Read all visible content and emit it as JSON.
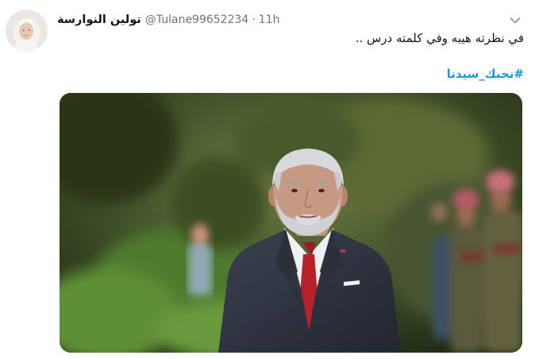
{
  "tweet": {
    "display_name": "تولين النوارسة",
    "handle": "@Tulane99652234",
    "separator": "·",
    "time": "11h",
    "text": "في نظرته هيبه وفي كلمته درس ..",
    "hashtag": "#نحبك_سيدنا"
  },
  "icons": {
    "menu": "chevron-down-icon"
  },
  "colors": {
    "name": "#14171a",
    "secondary": "#657786",
    "hashtag": "#1b95e0",
    "background": "#ffffff"
  }
}
